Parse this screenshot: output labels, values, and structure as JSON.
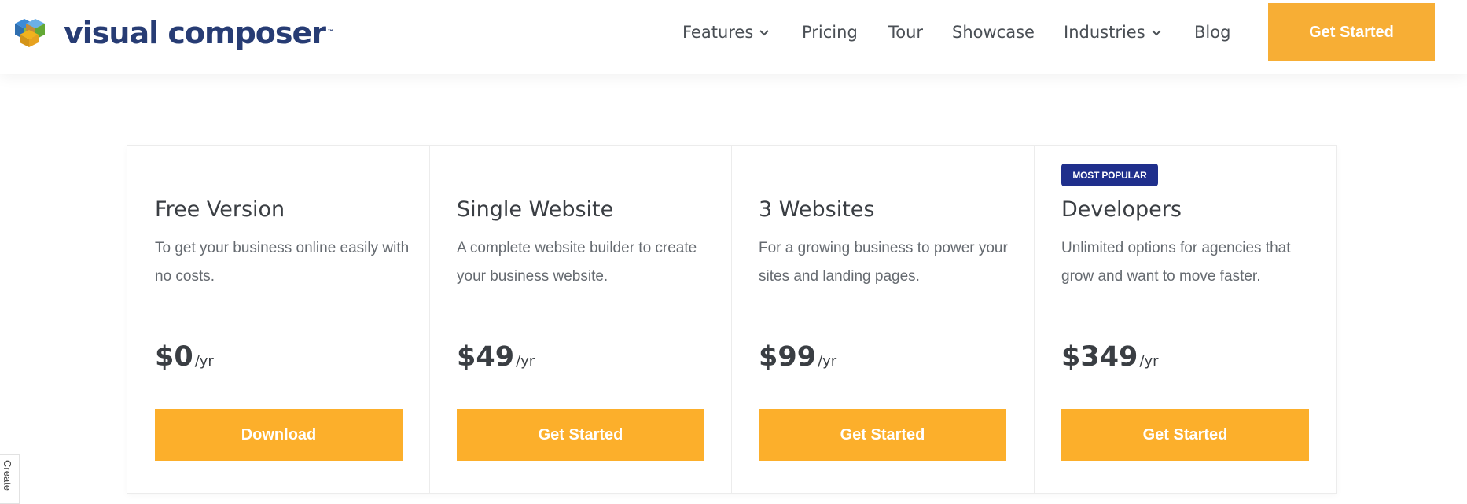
{
  "brand": {
    "name": "visual composer",
    "trademark": "™"
  },
  "nav": {
    "items": [
      {
        "label": "Features",
        "has_dropdown": true
      },
      {
        "label": "Pricing",
        "has_dropdown": false
      },
      {
        "label": "Tour",
        "has_dropdown": false
      },
      {
        "label": "Showcase",
        "has_dropdown": false
      },
      {
        "label": "Industries",
        "has_dropdown": true
      },
      {
        "label": "Blog",
        "has_dropdown": false
      }
    ],
    "cta_label": "Get Started"
  },
  "plans": [
    {
      "title": "Free Version",
      "description": "To get your business online easily with no costs.",
      "price": "$0",
      "period": "/yr",
      "button_label": "Download"
    },
    {
      "title": "Single Website",
      "description": "A complete website builder to create your business website.",
      "price": "$49",
      "period": "/yr",
      "button_label": "Get Started"
    },
    {
      "title": "3 Websites",
      "description": "For a growing business to power your sites and landing pages.",
      "price": "$99",
      "period": "/yr",
      "button_label": "Get Started"
    },
    {
      "title": "Developers",
      "badge": "MOST POPULAR",
      "description": "Unlimited options for agencies that grow and want to move faster.",
      "price": "$349",
      "period": "/yr",
      "button_label": "Get Started"
    }
  ],
  "side_tab": {
    "label": "Create"
  },
  "colors": {
    "accent": "#fcaf2b",
    "header_cta": "#f7ae35",
    "badge": "#1f2f8c",
    "brand_text": "#273c74"
  },
  "icons": [
    "logo-cubes-icon",
    "chevron-down-icon"
  ]
}
